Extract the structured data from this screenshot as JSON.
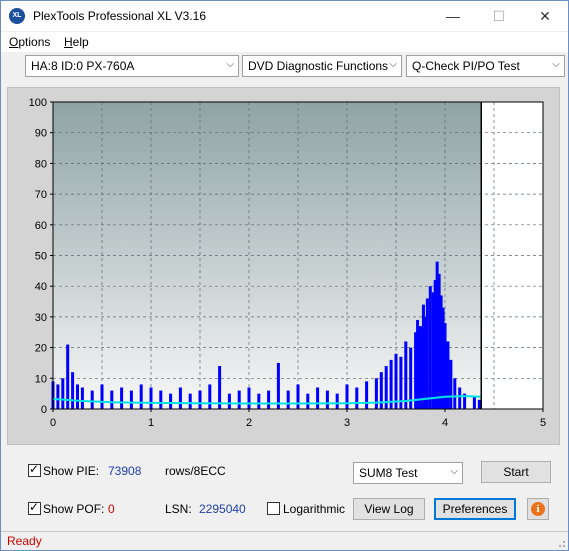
{
  "window": {
    "title": "PlexTools Professional XL V3.16",
    "app_icon_text": "XL",
    "minimize": "—",
    "maximize": "☐",
    "close": "✕"
  },
  "menu": [
    {
      "label": "Options",
      "accel": "O"
    },
    {
      "label": "Help",
      "accel": "H"
    }
  ],
  "toolbar": {
    "drive": "HA:8 ID:0  PX-760A",
    "function": "DVD Diagnostic Functions",
    "test": "Q-Check PI/PO Test"
  },
  "chart_data": {
    "type": "bar",
    "xlim": [
      0,
      5
    ],
    "ylim": [
      0,
      100
    ],
    "x_ticks": [
      "0",
      "1",
      "2",
      "3",
      "4",
      "5"
    ],
    "y_ticks": [
      "0",
      "10",
      "20",
      "30",
      "40",
      "50",
      "60",
      "70",
      "80",
      "90",
      "100"
    ],
    "disc_end_x": 4.37,
    "grid": true,
    "colors": {
      "bars": "#0000ff",
      "average_line": "#00e5e5",
      "plot_bg_top": "#8fa3a5",
      "plot_bg_bottom": "#f7f7f7",
      "past_end_bg": "#ffffff"
    },
    "series": [
      {
        "kind": "pie_bars",
        "points": [
          [
            0.0,
            9
          ],
          [
            0.05,
            8
          ],
          [
            0.1,
            10
          ],
          [
            0.15,
            21
          ],
          [
            0.2,
            12
          ],
          [
            0.25,
            8
          ],
          [
            0.3,
            7
          ],
          [
            0.4,
            6
          ],
          [
            0.5,
            8
          ],
          [
            0.6,
            6
          ],
          [
            0.7,
            7
          ],
          [
            0.8,
            6
          ],
          [
            0.9,
            8
          ],
          [
            1.0,
            7
          ],
          [
            1.1,
            6
          ],
          [
            1.2,
            5
          ],
          [
            1.3,
            7
          ],
          [
            1.4,
            5
          ],
          [
            1.5,
            6
          ],
          [
            1.6,
            8
          ],
          [
            1.7,
            14
          ],
          [
            1.8,
            5
          ],
          [
            1.9,
            6
          ],
          [
            2.0,
            7
          ],
          [
            2.1,
            5
          ],
          [
            2.2,
            6
          ],
          [
            2.3,
            15
          ],
          [
            2.4,
            6
          ],
          [
            2.5,
            8
          ],
          [
            2.6,
            5
          ],
          [
            2.7,
            7
          ],
          [
            2.8,
            6
          ],
          [
            2.9,
            5
          ],
          [
            3.0,
            8
          ],
          [
            3.1,
            7
          ],
          [
            3.2,
            9
          ],
          [
            3.3,
            10
          ],
          [
            3.35,
            12
          ],
          [
            3.4,
            14
          ],
          [
            3.45,
            16
          ],
          [
            3.5,
            18
          ],
          [
            3.55,
            17
          ],
          [
            3.6,
            22
          ],
          [
            3.65,
            20
          ],
          [
            3.7,
            25
          ],
          [
            3.72,
            29
          ],
          [
            3.75,
            27
          ],
          [
            3.78,
            34
          ],
          [
            3.8,
            30
          ],
          [
            3.82,
            36
          ],
          [
            3.85,
            40
          ],
          [
            3.88,
            38
          ],
          [
            3.9,
            42
          ],
          [
            3.92,
            48
          ],
          [
            3.94,
            44
          ],
          [
            3.96,
            37
          ],
          [
            3.98,
            33
          ],
          [
            4.0,
            28
          ],
          [
            4.03,
            22
          ],
          [
            4.06,
            16
          ],
          [
            4.1,
            10
          ],
          [
            4.15,
            7
          ],
          [
            4.2,
            5
          ],
          [
            4.3,
            4
          ],
          [
            4.35,
            3
          ]
        ]
      },
      {
        "kind": "average_line",
        "points": [
          [
            0.0,
            3.3
          ],
          [
            0.3,
            2.6
          ],
          [
            0.6,
            2.2
          ],
          [
            1.0,
            2.0
          ],
          [
            1.5,
            1.9
          ],
          [
            2.0,
            1.8
          ],
          [
            2.5,
            1.8
          ],
          [
            3.0,
            1.9
          ],
          [
            3.3,
            2.1
          ],
          [
            3.6,
            2.6
          ],
          [
            3.8,
            3.3
          ],
          [
            4.0,
            4.0
          ],
          [
            4.2,
            4.2
          ],
          [
            4.37,
            4.0
          ]
        ]
      }
    ]
  },
  "bottom": {
    "show_pie_label": "Show PIE:",
    "show_pie_accel": "P",
    "pie_value": "73908",
    "pie_unit": "rows/8ECC",
    "show_pof_label": "Show POF:",
    "pof_value": "0",
    "lsn_label": "LSN:",
    "lsn_value": "2295040",
    "logarithmic_label": "Logarithmic",
    "test_select": "SUM8 Test",
    "start_label": "Start",
    "view_log_label": "View Log",
    "preferences_label": "Preferences",
    "info_icon": "i"
  },
  "status": {
    "text": "Ready"
  }
}
